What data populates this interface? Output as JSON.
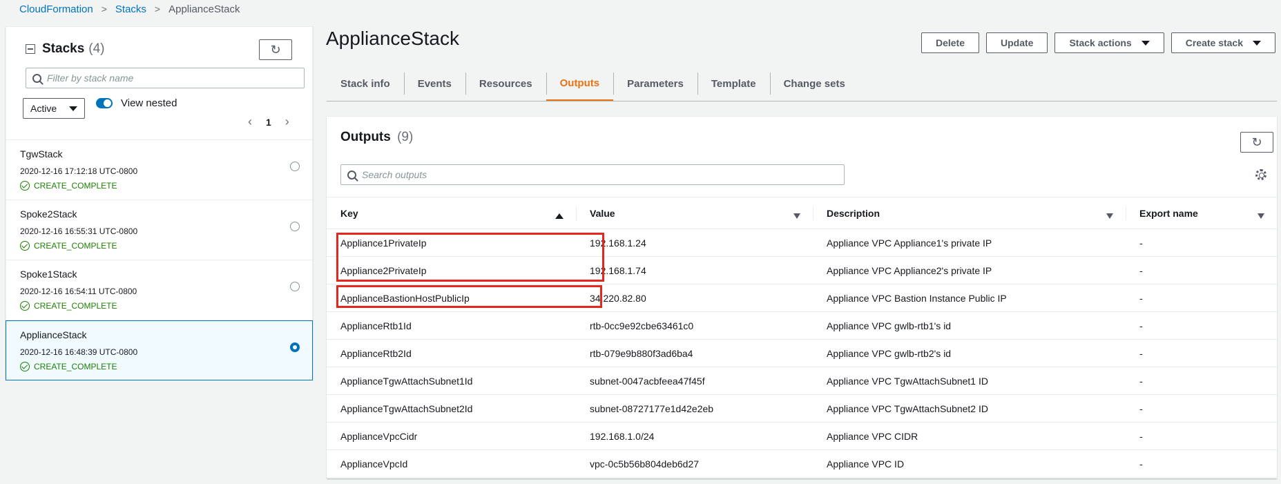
{
  "breadcrumb": {
    "items": [
      "CloudFormation",
      "Stacks"
    ],
    "current": "ApplianceStack"
  },
  "stacks_panel": {
    "title": "Stacks",
    "count": "(4)",
    "search_placeholder": "Filter by stack name",
    "status_filter": "Active",
    "view_nested_label": "View nested",
    "view_nested_on": true,
    "page": "1",
    "items": [
      {
        "name": "TgwStack",
        "time": "2020-12-16 17:12:18 UTC-0800",
        "status": "CREATE_COMPLETE",
        "selected": false
      },
      {
        "name": "Spoke2Stack",
        "time": "2020-12-16 16:55:31 UTC-0800",
        "status": "CREATE_COMPLETE",
        "selected": false
      },
      {
        "name": "Spoke1Stack",
        "time": "2020-12-16 16:54:11 UTC-0800",
        "status": "CREATE_COMPLETE",
        "selected": false
      },
      {
        "name": "ApplianceStack",
        "time": "2020-12-16 16:48:39 UTC-0800",
        "status": "CREATE_COMPLETE",
        "selected": true
      }
    ]
  },
  "page_title": "ApplianceStack",
  "actions": {
    "delete": "Delete",
    "update": "Update",
    "stack_actions": "Stack actions",
    "create_stack": "Create stack"
  },
  "tabs": [
    "Stack info",
    "Events",
    "Resources",
    "Outputs",
    "Parameters",
    "Template",
    "Change sets"
  ],
  "active_tab": "Outputs",
  "outputs": {
    "title": "Outputs",
    "count": "(9)",
    "search_placeholder": "Search outputs",
    "columns": {
      "key": "Key",
      "value": "Value",
      "description": "Description",
      "export": "Export name"
    },
    "rows": [
      {
        "key": "Appliance1PrivateIp",
        "value": "192.168.1.24",
        "description": "Appliance VPC Appliance1's private IP",
        "export": "-"
      },
      {
        "key": "Appliance2PrivateIp",
        "value": "192.168.1.74",
        "description": "Appliance VPC Appliance2's private IP",
        "export": "-"
      },
      {
        "key": "ApplianceBastionHostPublicIp",
        "value": "34.220.82.80",
        "description": "Appliance VPC Bastion Instance Public IP",
        "export": "-"
      },
      {
        "key": "ApplianceRtb1Id",
        "value": "rtb-0cc9e92cbe63461c0",
        "description": "Appliance VPC gwlb-rtb1's id",
        "export": "-"
      },
      {
        "key": "ApplianceRtb2Id",
        "value": "rtb-079e9b880f3ad6ba4",
        "description": "Appliance VPC gwlb-rtb2's id",
        "export": "-"
      },
      {
        "key": "ApplianceTgwAttachSubnet1Id",
        "value": "subnet-0047acbfeea47f45f",
        "description": "Appliance VPC TgwAttachSubnet1 ID",
        "export": "-"
      },
      {
        "key": "ApplianceTgwAttachSubnet2Id",
        "value": "subnet-08727177e1d42e2eb",
        "description": "Appliance VPC TgwAttachSubnet2 ID",
        "export": "-"
      },
      {
        "key": "ApplianceVpcCidr",
        "value": "192.168.1.0/24",
        "description": "Appliance VPC CIDR",
        "export": "-"
      },
      {
        "key": "ApplianceVpcId",
        "value": "vpc-0c5b56b804deb6d27",
        "description": "Appliance VPC ID",
        "export": "-"
      }
    ]
  },
  "colors": {
    "link": "#0073bb",
    "active_tab": "#ec7211",
    "success": "#1d8102",
    "highlight": "#e3271c"
  }
}
